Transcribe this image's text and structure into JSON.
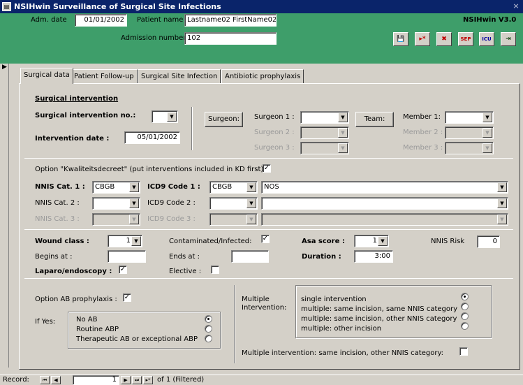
{
  "window": {
    "title": "NSIHwin Surveillance of Surgical Site Infections",
    "close": "×"
  },
  "header": {
    "adm_date_label": "Adm. date",
    "adm_date": "01/01/2002",
    "patient_name_label": "Patient name",
    "patient_name": "Lastname02 FirstName02",
    "admission_number_label": "Admission number",
    "admission_number": "102",
    "app_version": "NSIHwin  V3.0",
    "toolbar": [
      {
        "icon": "save-icon",
        "text": "💾"
      },
      {
        "icon": "new-record-icon",
        "text": "▸*"
      },
      {
        "icon": "delete-record-icon",
        "text": "✖"
      },
      {
        "icon": "sep-icon",
        "text": "SEP"
      },
      {
        "icon": "icu-icon",
        "text": "ICU"
      },
      {
        "icon": "exit-icon",
        "text": "⇥"
      }
    ]
  },
  "tabs": [
    "Surgical data",
    "Patient Follow-up",
    "Surgical Site Infection",
    "Antibiotic prophylaxis"
  ],
  "surgical": {
    "section_title": "Surgical intervention",
    "intervention_no_label": "Surgical intervention no.:",
    "intervention_no": "",
    "intervention_date_label": "Intervention date :",
    "intervention_date": "05/01/2002",
    "surgeon_button": "Surgeon:",
    "surgeon1_label": "Surgeon 1 :",
    "surgeon2_label": "Surgeon 2 :",
    "surgeon3_label": "Surgeon 3 :",
    "team_button": "Team:",
    "member1_label": "Member 1:",
    "member2_label": "Member 2 :",
    "member3_label": "Member 3 :"
  },
  "kd": {
    "option_label": "Option \"Kwaliteitsdecreet\" (put interventions included in KD first):",
    "checked": "✓"
  },
  "nnis": {
    "cat1_label": "NNIS Cat. 1 :",
    "cat1": "CBGB",
    "icd1_label": "ICD9 Code 1 :",
    "icd1": "CBGB",
    "icd1_desc": "NOS",
    "cat2_label": "NNIS Cat. 2 :",
    "icd2_label": "ICD9 Code 2 :",
    "cat3_label": "NNIS Cat. 3 :",
    "icd3_label": "ICD9 Code 3 :"
  },
  "wound": {
    "wound_class_label": "Wound class :",
    "wound_class": "1",
    "contaminated_label": "Contaminated/Infected:",
    "contaminated": "✓",
    "asa_label": "Asa score :",
    "asa": "1",
    "nnis_risk_label": "NNIS Risk",
    "nnis_risk": "0",
    "begins_label": "Begins at :",
    "ends_label": "Ends at :",
    "duration_label": "Duration :",
    "duration": "3:00",
    "laparo_label": "Laparo/endoscopy :",
    "laparo": "✓",
    "elective_label": "Elective :",
    "elective": ""
  },
  "prophylaxis": {
    "option_label": "Option AB prophylaxis :",
    "option_checked": "✓",
    "if_yes_label": "If Yes:",
    "options": [
      "No AB",
      "Routine ABP",
      "Therapeutic AB or exceptional ABP"
    ],
    "selected": 0
  },
  "multiple": {
    "label": "Multiple Intervention:",
    "options": [
      "single intervention",
      "multiple: same incision, same NNIS category",
      "multiple: same incision, other NNIS category",
      "multiple: other incision"
    ],
    "selected": 0,
    "other_cat_label": "Multiple intervention: same incision, other NNIS category:",
    "other_cat": ""
  },
  "navigation": {
    "record_label": "Record:",
    "record_number": "1",
    "of_text": "of 1 (Filtered)"
  }
}
